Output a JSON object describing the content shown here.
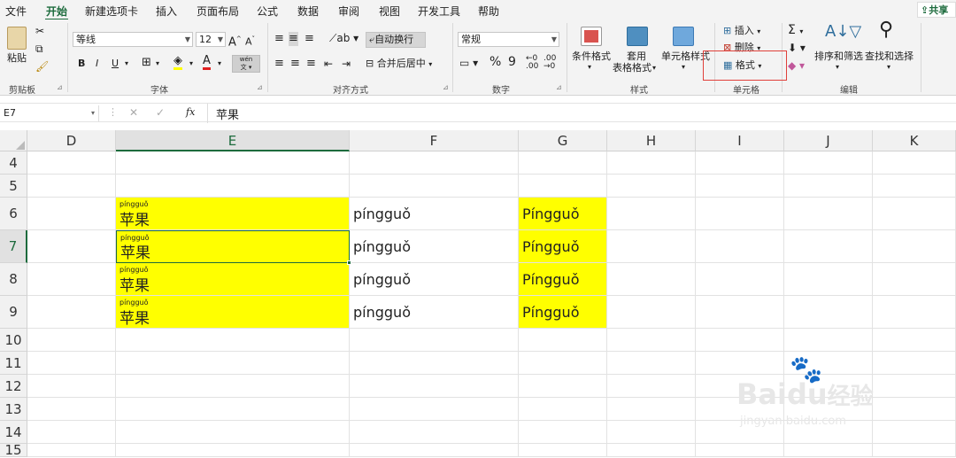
{
  "tabs": {
    "file": "文件",
    "home": "开始",
    "newtab": "新建选项卡",
    "insert": "插入",
    "layout": "页面布局",
    "formulas": "公式",
    "data": "数据",
    "review": "审阅",
    "view": "视图",
    "developer": "开发工具",
    "help": "帮助"
  },
  "share": "共享",
  "ribbon": {
    "clipboard": {
      "paste": "粘贴",
      "label": "剪贴板"
    },
    "font": {
      "name": "等线",
      "size": "12",
      "label": "字体",
      "bold": "B",
      "italic": "I",
      "underline": "U",
      "a_up": "A",
      "a_down": "A",
      "wen": "wén"
    },
    "align": {
      "wrap": "自动换行",
      "merge": "合并后居中",
      "label": "对齐方式"
    },
    "number": {
      "format": "常规",
      "percent": "%",
      "comma": "9",
      "label": "数字"
    },
    "styles": {
      "cond": "条件格式",
      "table_line1": "套用",
      "table_line2": "表格格式",
      "cell": "单元格样式",
      "label": "样式"
    },
    "cells": {
      "insert": "插入",
      "delete": "删除",
      "format": "格式",
      "label": "单元格"
    },
    "edit": {
      "sort": "排序和筛选",
      "find": "查找和选择",
      "label": "编辑",
      "sigma": "Σ"
    }
  },
  "formula_bar": {
    "name_box": "E7",
    "cancel": "✕",
    "confirm": "✓",
    "fx": "fx",
    "value": "苹果"
  },
  "columns": [
    "D",
    "E",
    "F",
    "G",
    "H",
    "I",
    "J",
    "K"
  ],
  "rows": [
    "4",
    "5",
    "6",
    "7",
    "8",
    "9",
    "10",
    "11",
    "12",
    "13",
    "14",
    "15"
  ],
  "cells": {
    "ruby": "píngguǒ",
    "chinese": "苹果",
    "f": "píngguǒ",
    "g": "Píngguǒ"
  },
  "colors": {
    "accent": "#1d6b3d",
    "highlight": "#ffff00",
    "callout": "#e0403a"
  },
  "watermark": {
    "brand": "Baidu",
    "site": "经验",
    "url": "jingyan.baidu.com"
  }
}
